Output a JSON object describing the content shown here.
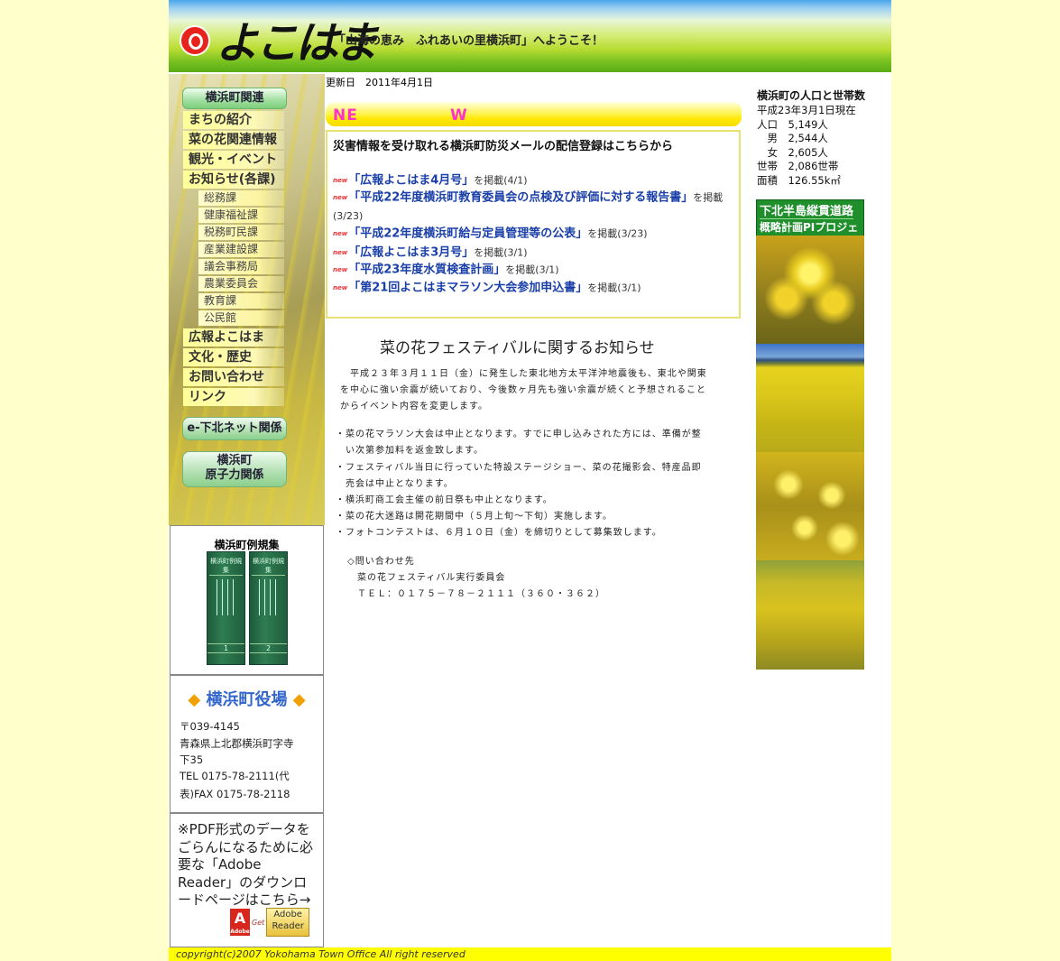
{
  "header": {
    "logo_text": "よこはま",
    "welcome": "「山海の恵み　ふれあいの里横浜町」へようこそ！"
  },
  "leftnav": {
    "section_title": "横浜町関連",
    "items": [
      "まちの紹介",
      "菜の花関連情報",
      "観光・イベント",
      "お知らせ(各課)"
    ],
    "subitems": [
      "総務課",
      "健康福祉課",
      "税務町民課",
      "産業建設課",
      "議会事務局",
      "農業委員会",
      "教育課",
      "公民館"
    ],
    "items2": [
      "広報よこはま",
      "文化・歴史",
      "お問い合わせ",
      "リンク"
    ],
    "btn_eshimokita": "e-下北ネット関係",
    "btn_nuclear_1": "横浜町",
    "btn_nuclear_2": "原子力関係"
  },
  "reiki": {
    "title": "横浜町例規集",
    "book1_title": "横浜町例規集",
    "book2_title": "横浜町例規集",
    "book1_num": "1",
    "book2_num": "2"
  },
  "office": {
    "title": "横浜町役場",
    "diamond_left": "◆",
    "diamond_right": "◆",
    "postal": "〒039-4145",
    "address1": "青森県上北郡横浜町字寺",
    "address2": "下35",
    "tel": "TEL 0175-78-2111(代",
    "fax": "表)FAX 0175-78-2118"
  },
  "pdf": {
    "text": "※PDF形式のデータをごらんになるために必要な「Adobe Reader」のダウンロードページはこちら→",
    "adobe_a": "A",
    "adobe_small": "Adobe",
    "get": "Get",
    "reader_line1": "Adobe",
    "reader_line2": "Reader"
  },
  "main": {
    "update_label": "更新日　2011年4月1日",
    "news_label": "NE",
    "news_label_w": "W",
    "headline": "災害情報を受け取れる横浜町防災メールの配信登録はこちらから",
    "new_badge": "new",
    "news": [
      {
        "link": "「広報よこはま4月号」",
        "suffix": "を掲載(4/1)"
      },
      {
        "link": "「平成22年度横浜町教育委員会の点検及び評価に対する報告書」",
        "suffix": "を掲載(3/23)"
      },
      {
        "link": "「平成22年度横浜町給与定員管理等の公表」",
        "suffix": "を掲載(3/23)"
      },
      {
        "link": "「広報よこはま3月号」",
        "suffix": "を掲載(3/1)"
      },
      {
        "link": "「平成23年度水質検査計画」",
        "suffix": "を掲載(3/1)"
      },
      {
        "link": "「第21回よこはまマラソン大会参加申込書」",
        "suffix": "を掲載(3/1)"
      }
    ],
    "article_title": "菜の花フェスティバルに関するお知らせ",
    "intro1": "　平成２３年３月１１日（金）に発生した東北地方太平洋沖地震後も、東北や関東",
    "intro2": "を中心に強い余震が続いており、今後数ヶ月先も強い余震が続くと予想されること",
    "intro3": "からイベント内容を変更します。",
    "bullets": [
      "・菜の花マラソン大会は中止となります。すでに申し込みされた方には、準備が整",
      "　い次第参加料を返金致します。",
      "・フェスティバル当日に行っていた特設ステージショー、菜の花撮影会、特産品即",
      "　売会は中止となります。",
      "・横浜町商工会主催の前日祭も中止となります。",
      "・菜の花大迷路は開花期間中（５月上旬～下旬）実施します。",
      "・フォトコンテストは、６月１０日（金）を締切りとして募集致します。"
    ],
    "contact_label": "◇問い合わせ先",
    "contact_org": "菜の花フェスティバル実行委員会",
    "contact_tel": "ＴＥＬ：０１７５－７８－２１１１（３６０・３６２）"
  },
  "population": {
    "title": "横浜町の人口と世帯数",
    "as_of": "平成23年3月1日現在",
    "lines": [
      "人口　5,149人",
      "　男　2,544人",
      "　女　2,605人",
      "世帯　2,086世帯",
      "面積　126.55k㎡"
    ]
  },
  "project": {
    "line1": "下北半島縦貫道路",
    "line2": "概略計画PIプロジェクト"
  },
  "footer": {
    "copyright": "copyright(c)2007 Yokohama Town Office All right reserved"
  }
}
